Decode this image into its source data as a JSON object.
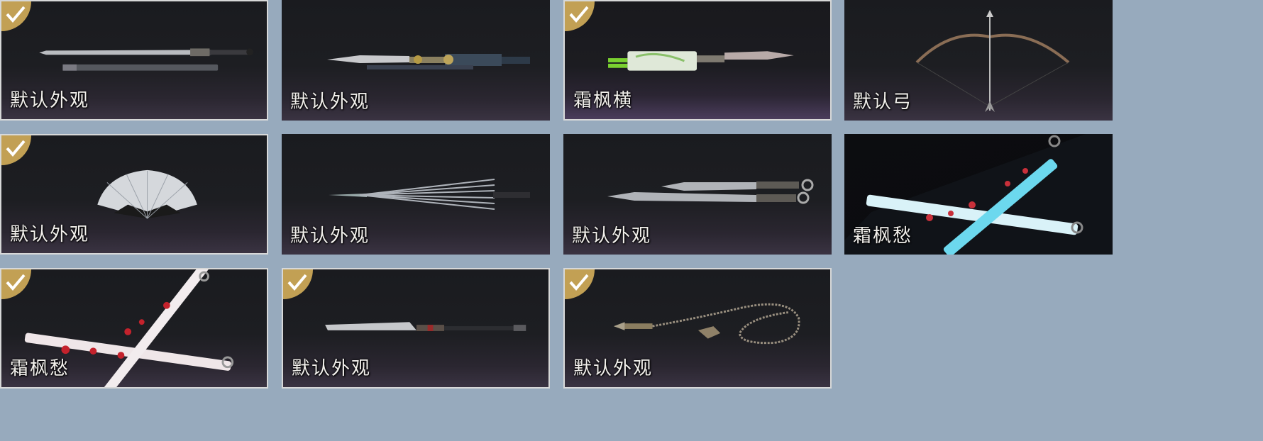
{
  "cards": [
    {
      "name": "默认外观",
      "owned": true
    },
    {
      "name": "默认外观",
      "owned": false
    },
    {
      "name": "霜枫横",
      "owned": true
    },
    {
      "name": "默认弓",
      "owned": false
    },
    {
      "name": "默认外观",
      "owned": true
    },
    {
      "name": "默认外观",
      "owned": false
    },
    {
      "name": "默认外观",
      "owned": false
    },
    {
      "name": "霜枫愁",
      "owned": false
    },
    {
      "name": "霜枫愁",
      "owned": true
    },
    {
      "name": "默认外观",
      "owned": true
    },
    {
      "name": "默认外观",
      "owned": true
    }
  ],
  "colors": {
    "background": "#97aabd",
    "check_badge": "#c2a054",
    "owned_border": "#d7d8d8"
  },
  "icons": {
    "owned": "checkmark-badge-icon"
  }
}
